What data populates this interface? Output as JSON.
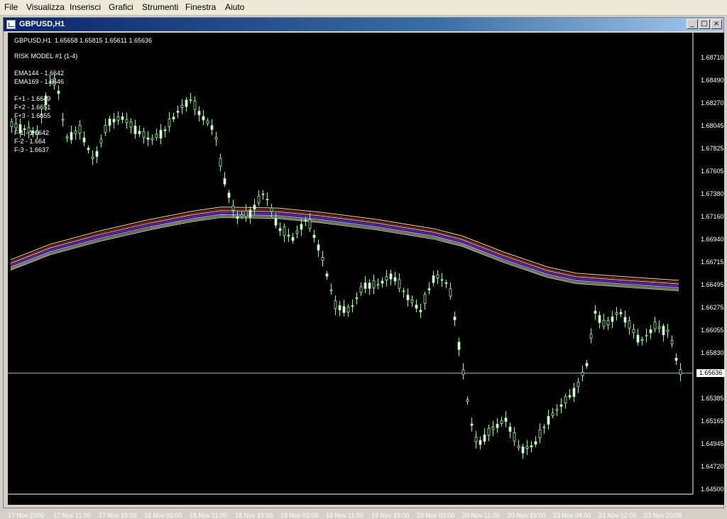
{
  "menu": [
    "File",
    "Visualizza",
    "Inserisci",
    "Grafici",
    "Strumenti",
    "Finestra",
    "Aiuto"
  ],
  "window": {
    "title": "GBPUSD,H1"
  },
  "info": {
    "ohlc": "GBPUSD,H1  1.65658 1.65815 1.65611 1.65636",
    "model": "RISK MODEL #1 (1-4)",
    "ema144": "EMA144 - 1.6642",
    "ema169": "EMA169 - 1.6646",
    "f_plus": [
      "F+1 - 1.6649",
      "F+2 - 1.6651",
      "F+3 - 1.6655"
    ],
    "f_minus": [
      "F-1 - 1.6642",
      "F-2 - 1.664",
      "F-3 - 1.6637"
    ]
  },
  "price_axis": [
    "1.68710",
    "1.68490",
    "1.68270",
    "1.68045",
    "1.67825",
    "1.67605",
    "1.67380",
    "1.67160",
    "1.66940",
    "1.66715",
    "1.66495",
    "1.66275",
    "1.66055",
    "1.65830",
    "1.65385",
    "1.65165",
    "1.64945",
    "1.64720",
    "1.64500"
  ],
  "current_price": "1.65636",
  "time_axis": [
    "17 Nov 2009",
    "17 Nov 11:00",
    "17 Nov 19:00",
    "18 Nov 03:00",
    "18 Nov 11:00",
    "18 Nov 19:00",
    "19 Nov 03:00",
    "19 Nov 11:00",
    "19 Nov 19:00",
    "20 Nov 03:00",
    "20 Nov 11:00",
    "20 Nov 19:00",
    "23 Nov 04:00",
    "23 Nov 12:00",
    "23 Nov 20:00"
  ],
  "colors": {
    "candle": "#8cff8c",
    "bull_body": "#ffffff",
    "ema_red": "#ff2020",
    "ema_blue": "#2020ff",
    "band_yellow": "#e8e870",
    "band_white": "#e0e0e0",
    "grid_line": "#9ab0c0"
  }
}
